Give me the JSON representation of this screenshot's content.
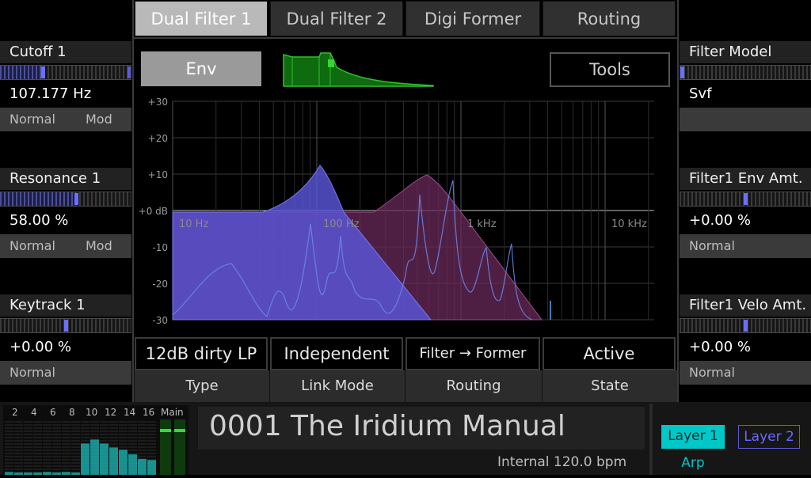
{
  "tabs": [
    "Dual Filter 1",
    "Dual Filter 2",
    "Digi Former",
    "Routing"
  ],
  "left_params": [
    {
      "label": "Cutoff 1",
      "value": "107.177 Hz",
      "mode": "Normal",
      "mod": "Mod",
      "level": 0.33
    },
    {
      "label": "Resonance 1",
      "value": "58.00 %",
      "mode": "Normal",
      "mod": "Mod",
      "level": 0.58
    },
    {
      "label": "Keytrack 1",
      "value": "+0.00 %",
      "mode": "Normal",
      "mod": "",
      "level": 0.5
    }
  ],
  "right_params": [
    {
      "label": "Filter Model",
      "value": "Svf",
      "mode": "",
      "level": 0.0
    },
    {
      "label": "Filter1 Env Amt.",
      "value": "+0.00 %",
      "mode": "Normal",
      "level": 0.5
    },
    {
      "label": "Filter1 Velo Amt.",
      "value": "+0.00 %",
      "mode": "Normal",
      "level": 0.5
    }
  ],
  "buttons": {
    "env": "Env",
    "tools": "Tools"
  },
  "graph": {
    "y_ticks": [
      "+30",
      "+20",
      "+10",
      "+0 dB",
      "-10",
      "-20",
      "-30"
    ],
    "x_ticks": [
      "10 Hz",
      "100 Hz",
      "1 kHz",
      "10 kHz"
    ]
  },
  "bottom_params": [
    {
      "value": "12dB dirty LP",
      "name": "Type"
    },
    {
      "value": "Independent",
      "name": "Link Mode"
    },
    {
      "value": "Filter → Former",
      "name": "Routing"
    },
    {
      "value": "Active",
      "name": "State"
    }
  ],
  "meter": {
    "labels": [
      "2",
      "4",
      "6",
      "8",
      "10",
      "12",
      "14",
      "16"
    ],
    "main_label": "Main",
    "levels": [
      0.05,
      0.04,
      0.04,
      0.04,
      0.05,
      0.04,
      0.05,
      0.04,
      0.55,
      0.62,
      0.55,
      0.48,
      0.44,
      0.36,
      0.28,
      0.26
    ]
  },
  "patch": {
    "name": "0001 The Iridium Manual",
    "tempo": "Internal 120.0 bpm"
  },
  "layers": {
    "layer1": "Layer 1",
    "layer2": "Layer 2",
    "arp": "Arp"
  },
  "colors": {
    "accent": "#00c8c8",
    "filter1": "#5a55d8",
    "filter2": "#6a2a5a",
    "env": "#1f8a1f"
  }
}
